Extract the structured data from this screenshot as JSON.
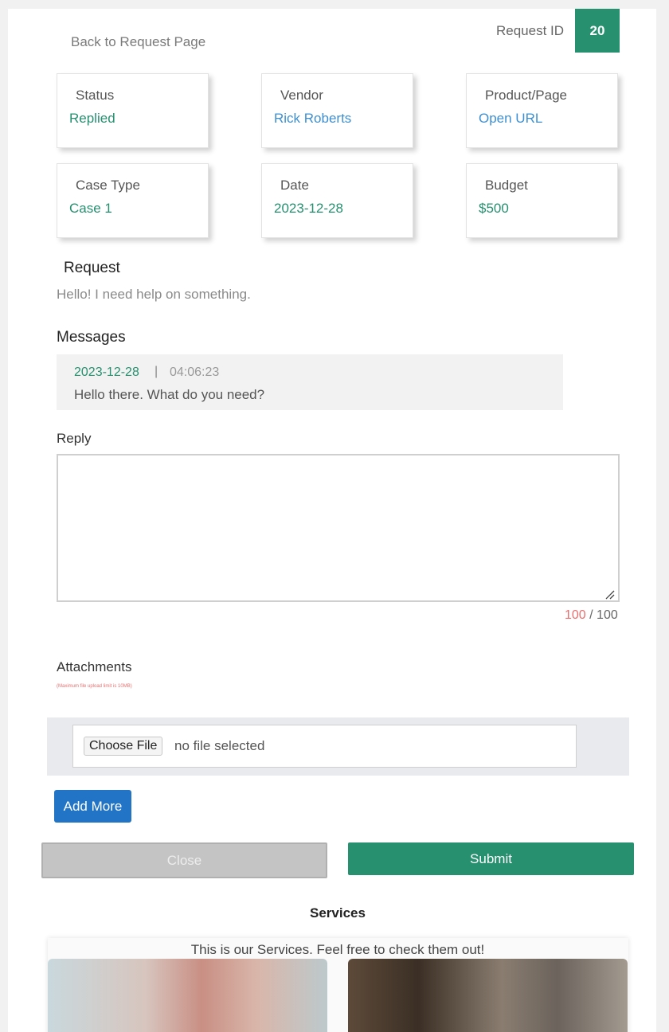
{
  "header": {
    "back_link": "Back to Request Page",
    "request_id_label": "Request ID",
    "request_id": "20"
  },
  "cards": {
    "status": {
      "label": "Status",
      "value": "Replied"
    },
    "vendor": {
      "label": "Vendor",
      "value": "Rick Roberts"
    },
    "product": {
      "label": "Product/Page",
      "value": "Open URL"
    },
    "case_type": {
      "label": "Case Type",
      "value": "Case 1"
    },
    "date": {
      "label": "Date",
      "value": "2023-12-28"
    },
    "budget": {
      "label": "Budget",
      "value": "$500"
    }
  },
  "request": {
    "title": "Request",
    "text": "Hello! I need help on something."
  },
  "messages": {
    "title": "Messages",
    "items": [
      {
        "date": "2023-12-28",
        "separator": "|",
        "time": "04:06:23",
        "text": "Hello there. What do you need?"
      }
    ]
  },
  "reply": {
    "label": "Reply",
    "value": "",
    "counter_used": "100",
    "counter_max": "/ 100"
  },
  "attachments": {
    "label": "Attachments",
    "note": "(Maximum file upload limit is 10MB)",
    "choose_label": "Choose File",
    "no_file": "no file selected",
    "add_more": "Add More"
  },
  "actions": {
    "close": "Close",
    "submit": "Submit"
  },
  "services": {
    "title": "Services",
    "subtitle": "This is our Services. Feel free to check them out!"
  },
  "colors": {
    "accent_green": "#26906f",
    "link_blue": "#3d8fd1",
    "button_blue": "#2274c6",
    "warning_red": "#e96f6f"
  }
}
